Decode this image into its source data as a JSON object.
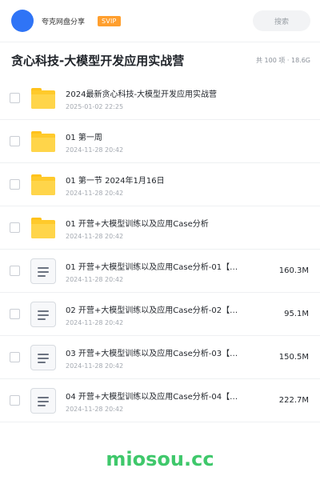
{
  "header": {
    "username": "夸克网盘分享",
    "badge": "SVIP",
    "search_placeholder": "搜索"
  },
  "title": {
    "text": "贪心科技-大模型开发应用实战营",
    "meta": "共 100 项 · 18.6G"
  },
  "files": [
    {
      "type": "folder",
      "name": "2024最新贪心科技-大模型开发应用实战营",
      "date": "2025-01-02 22:25",
      "size": ""
    },
    {
      "type": "folder",
      "name": "01 第一周",
      "date": "2024-11-28 20:42",
      "size": ""
    },
    {
      "type": "folder",
      "name": "01 第一节 2024年1月16日",
      "date": "2024-11-28 20:42",
      "size": ""
    },
    {
      "type": "folder",
      "name": "01 开营+大模型训练以及应用Case分析",
      "date": "2024-11-28 20:42",
      "size": ""
    },
    {
      "type": "doc",
      "name": "01 开营+大模型训练以及应用Case分析-01【…",
      "date": "2024-11-28 20:42",
      "size": "160.3M"
    },
    {
      "type": "doc",
      "name": "02 开营+大模型训练以及应用Case分析-02【…",
      "date": "2024-11-28 20:42",
      "size": "95.1M"
    },
    {
      "type": "doc",
      "name": "03 开营+大模型训练以及应用Case分析-03【…",
      "date": "2024-11-28 20:42",
      "size": "150.5M"
    },
    {
      "type": "doc",
      "name": "04 开营+大模型训练以及应用Case分析-04【…",
      "date": "2024-11-28 20:42",
      "size": "222.7M"
    }
  ],
  "watermark": "miosou.cc",
  "colors": {
    "accent": "#2f74f6",
    "badge": "#ff9f2e",
    "folder": "#ffca2b",
    "watermark": "#3fc86b"
  },
  "icons": {
    "folder": "folder-icon",
    "doc": "document-icon"
  }
}
